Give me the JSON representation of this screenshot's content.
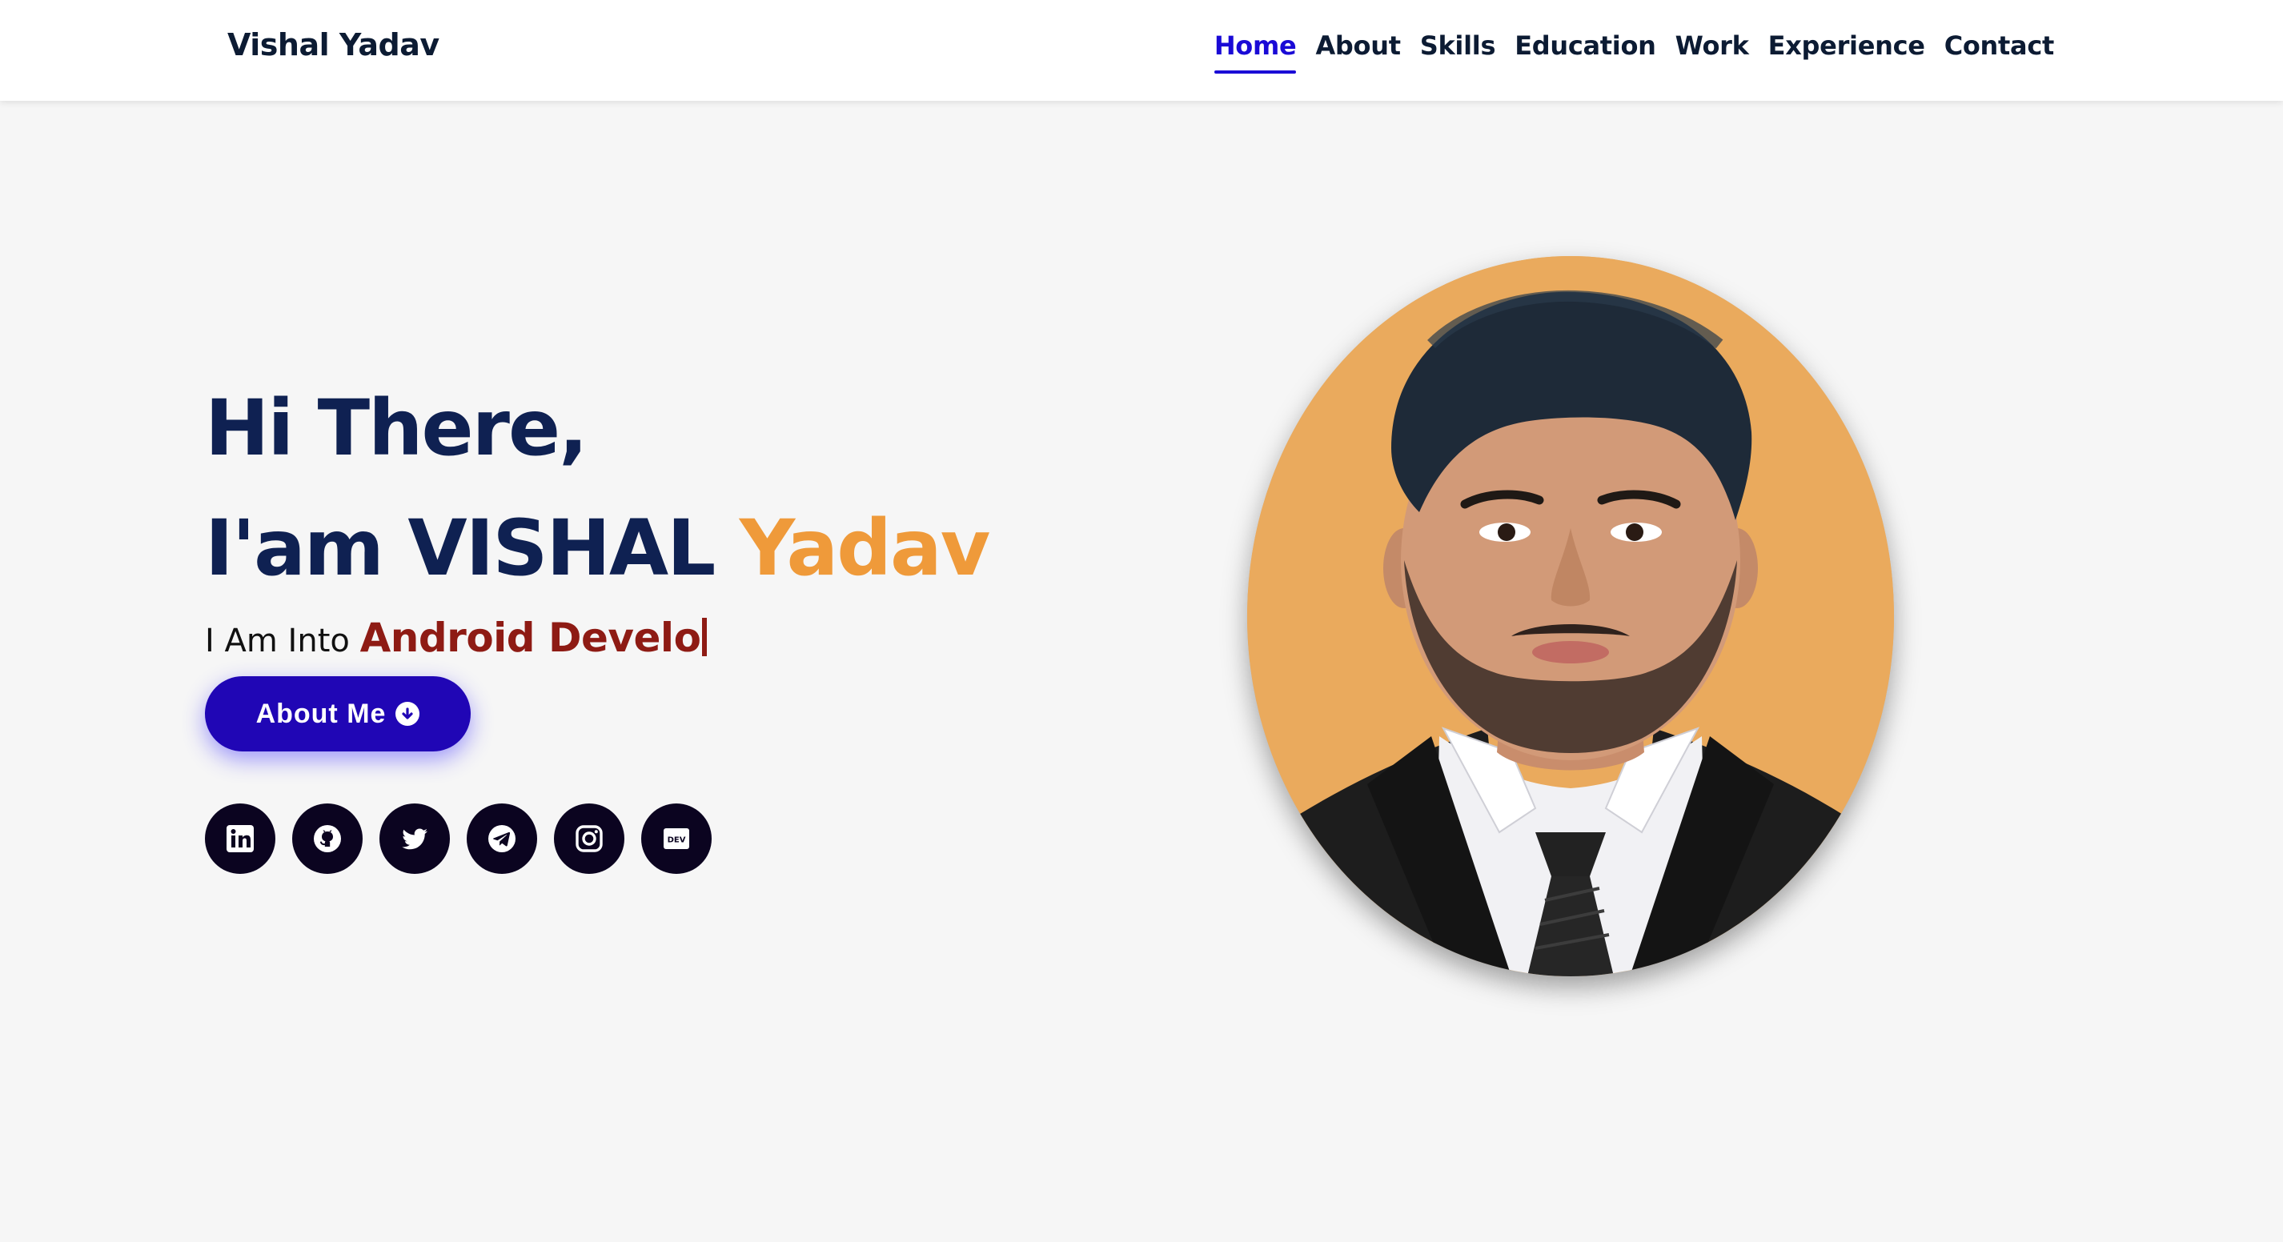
{
  "header": {
    "brand": "Vishal Yadav",
    "nav": [
      {
        "label": "Home",
        "active": true
      },
      {
        "label": "About",
        "active": false
      },
      {
        "label": "Skills",
        "active": false
      },
      {
        "label": "Education",
        "active": false
      },
      {
        "label": "Work",
        "active": false
      },
      {
        "label": "Experience",
        "active": false
      },
      {
        "label": "Contact",
        "active": false
      }
    ]
  },
  "hero": {
    "greeting": "Hi There,",
    "intro_prefix": "I'am VISHAL",
    "intro_accent": "Yadav",
    "typing_prefix": "I Am Into",
    "typing_text": "Android Develo",
    "button_label": "About Me",
    "button_icon": "arrow-circle-down-icon",
    "socials": [
      {
        "name": "linkedin",
        "icon": "linkedin-icon"
      },
      {
        "name": "github",
        "icon": "github-icon"
      },
      {
        "name": "twitter",
        "icon": "twitter-icon"
      },
      {
        "name": "telegram",
        "icon": "telegram-icon"
      },
      {
        "name": "instagram",
        "icon": "instagram-icon"
      },
      {
        "name": "dev",
        "icon": "dev-icon",
        "label": "DEV"
      }
    ]
  },
  "colors": {
    "navy": "#0f2152",
    "accent_orange": "#ef9a3a",
    "typing_red": "#8e1b14",
    "button_blue": "#2006b5",
    "active_nav": "#1a0ad6",
    "portrait_bg": "#eaaa5d",
    "page_bg": "#f6f6f6"
  }
}
